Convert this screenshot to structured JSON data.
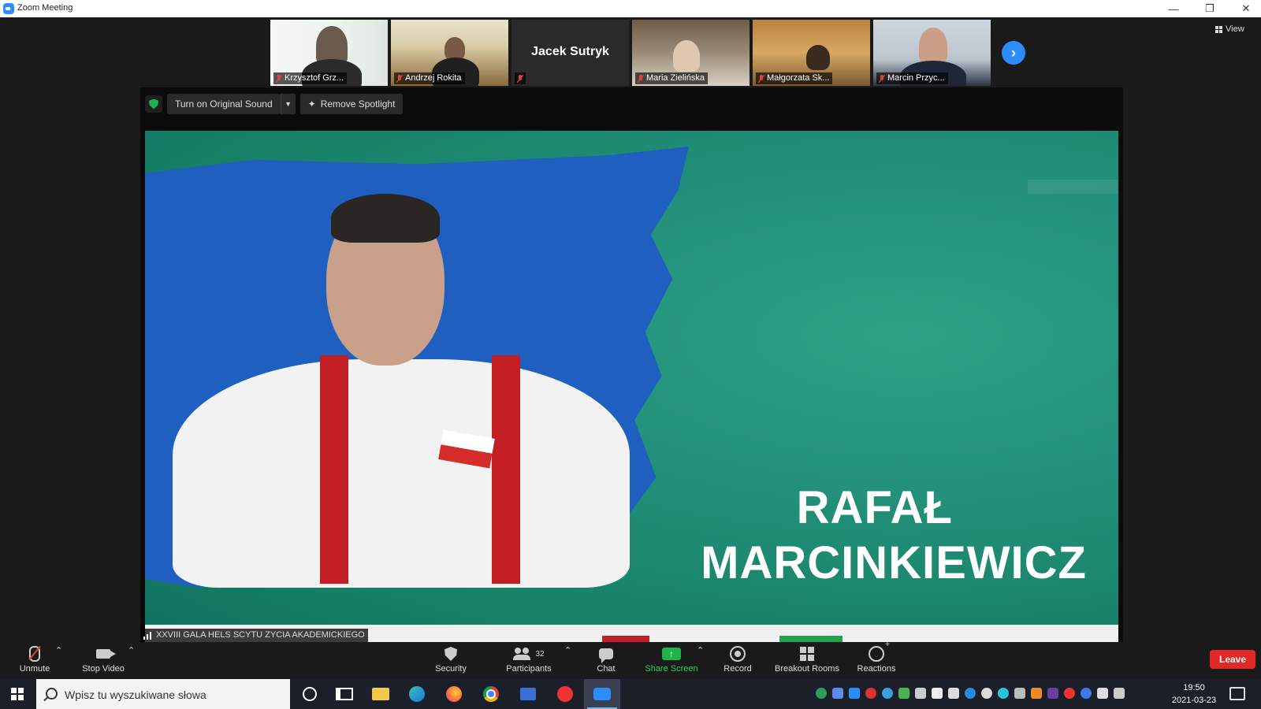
{
  "window": {
    "title": "Zoom Meeting",
    "controls": [
      "minimize",
      "restore",
      "close"
    ]
  },
  "thumbnails": [
    {
      "name": "Krzysztof Grz...",
      "muted": true
    },
    {
      "name": "Andrzej Rokita",
      "muted": true
    },
    {
      "name": "",
      "big_name": "Jacek Sutryk",
      "muted": true
    },
    {
      "name": "Maria Zielińska",
      "muted": true
    },
    {
      "name": "Małgorzata Sk...",
      "muted": true
    },
    {
      "name": "Marcin Przyc...",
      "muted": true
    }
  ],
  "view_button": "View",
  "stage": {
    "original_sound_label": "Turn on Original Sound",
    "remove_spotlight_label": "Remove Spotlight",
    "speaker_first": "RAFAŁ",
    "speaker_last": "MARCINKIEWICZ",
    "label": "XXVIII GALA HELS SCYTU ZYCIA AKADEMICKIEGO"
  },
  "controls": {
    "unmute": "Unmute",
    "stop_video": "Stop Video",
    "security": "Security",
    "participants": "Participants",
    "participants_count": "32",
    "chat": "Chat",
    "share_screen": "Share Screen",
    "record": "Record",
    "breakout_rooms": "Breakout Rooms",
    "reactions": "Reactions",
    "leave": "Leave"
  },
  "taskbar": {
    "search_placeholder": "Wpisz tu wyszukiwane słowa",
    "time": "19:50",
    "date": "2021-03-23"
  },
  "colors": {
    "zoom_blue": "#2d8cff",
    "share_green": "#21b34b",
    "leave_red": "#e02828",
    "backdrop_teal": "#1f8c76",
    "paint_blue": "#1f5fbf"
  }
}
